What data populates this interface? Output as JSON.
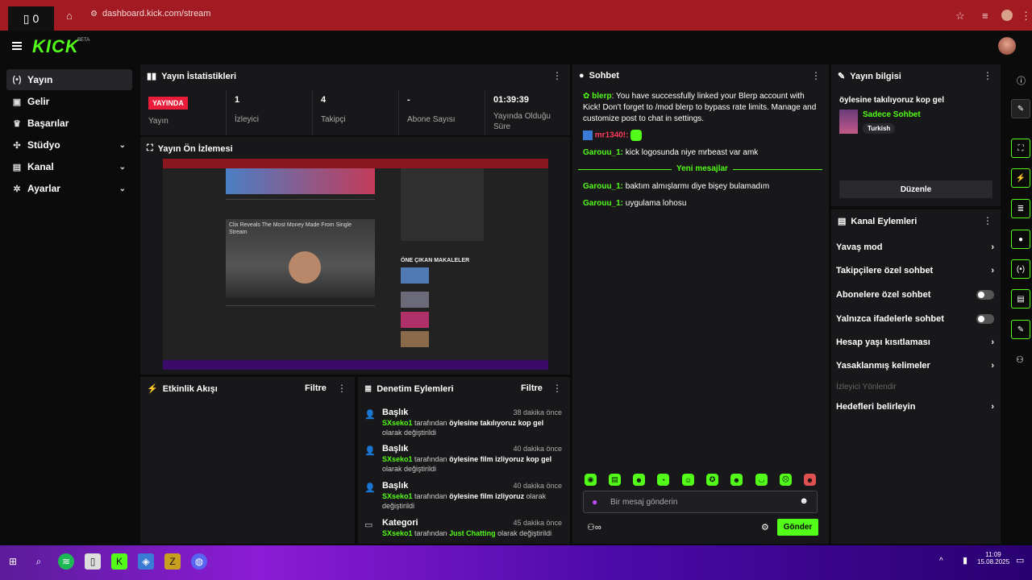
{
  "browser": {
    "tab_count": "0",
    "url": "dashboard.kick.com/stream"
  },
  "app": {
    "logo": "KICK",
    "beta": "BETA"
  },
  "sidebar": {
    "items": [
      {
        "label": "Yayın",
        "icon": "broadcast-icon"
      },
      {
        "label": "Gelir",
        "icon": "wallet-icon"
      },
      {
        "label": "Başarılar",
        "icon": "trophy-icon"
      },
      {
        "label": "Stüdyo",
        "icon": "studio-icon"
      },
      {
        "label": "Kanal",
        "icon": "channel-icon"
      },
      {
        "label": "Ayarlar",
        "icon": "gear-icon"
      }
    ]
  },
  "stats": {
    "title": "Yayın İstatistikleri",
    "live_badge": "YAYINDA",
    "live_label": "Yayın",
    "viewers_value": "1",
    "viewers_label": "İzleyici",
    "followers_value": "4",
    "followers_label": "Takipçi",
    "subs_value": "-",
    "subs_label": "Abone Sayısı",
    "uptime_value": "01:39:39",
    "uptime_label": "Yayında Olduğu Süre"
  },
  "preview": {
    "title": "Yayın Ön İzlemesi",
    "headline": "Clix Reveals The Most Money Made From Single Stream",
    "featured": "ÖNE ÇIKAN MAKALELER"
  },
  "activity": {
    "title": "Etkinlik Akışı",
    "filter": "Filtre"
  },
  "moderation": {
    "title": "Denetim Eylemleri",
    "filter": "Filtre",
    "items": [
      {
        "title": "Başlık",
        "time": "38 dakika önce",
        "user": "SXseko1",
        "mid": " tarafından ",
        "value": "öylesine takılıyoruz kop gel",
        "end": " olarak değiştirildi"
      },
      {
        "title": "Başlık",
        "time": "40 dakika önce",
        "user": "SXseko1",
        "mid": " tarafından ",
        "value": "öylesine film izliyoruz kop gel",
        "end": " olarak değiştirildi"
      },
      {
        "title": "Başlık",
        "time": "40 dakika önce",
        "user": "SXseko1",
        "mid": " tarafından ",
        "value": "öylesine film izliyoruz",
        "end": " olarak değiştirildi"
      },
      {
        "title": "Kategori",
        "time": "45 dakika önce",
        "user": "SXseko1",
        "mid": " tarafından ",
        "value": "Just Chatting",
        "end": " olarak değiştirildi"
      }
    ]
  },
  "chat": {
    "title": "Sohbet",
    "bot_name": "blerp",
    "bot_msg": ": You have successfully linked your Blerp account with Kick! Don't forget to /mod blerp to bypass rate limits. Manage and customize post to chat in settings.",
    "user2": "mr1340!:",
    "m1_user": "Garouu_1:",
    "m1_text": " kick logosunda niye mrbeast var amk",
    "new_messages": "Yeni mesajlar",
    "m2_user": "Garouu_1:",
    "m2_text": " baktım almışlarmı diye bişey bulamadım",
    "m3_user": "Garouu_1:",
    "m3_text": " uygulama lohosu",
    "placeholder": "Bir mesaj gönderin",
    "send": "Gönder"
  },
  "info": {
    "title": "Yayın bilgisi",
    "stream_title": "öylesine takılıyoruz kop gel",
    "category": "Sadece Sohbet",
    "language": "Turkish",
    "edit": "Düzenle"
  },
  "channel_actions": {
    "title": "Kanal Eylemleri",
    "slow": "Yavaş mod",
    "followers_only": "Takipçilere özel sohbet",
    "subs_only": "Abonelere özel sohbet",
    "emotes_only": "Yalnızca ifadelerle sohbet",
    "age": "Hesap yaşı kısıtlaması",
    "banned": "Yasaklanmış kelimeler",
    "viewer_guide": "İzleyici Yönlendir",
    "goals": "Hedefleri belirleyin"
  },
  "taskbar": {
    "time": "11:09",
    "date": "15.08.2025"
  },
  "colors": {
    "accent": "#53fc18",
    "live": "#e91d3a",
    "panel": "#18181b",
    "chrome": "#a21a22"
  }
}
